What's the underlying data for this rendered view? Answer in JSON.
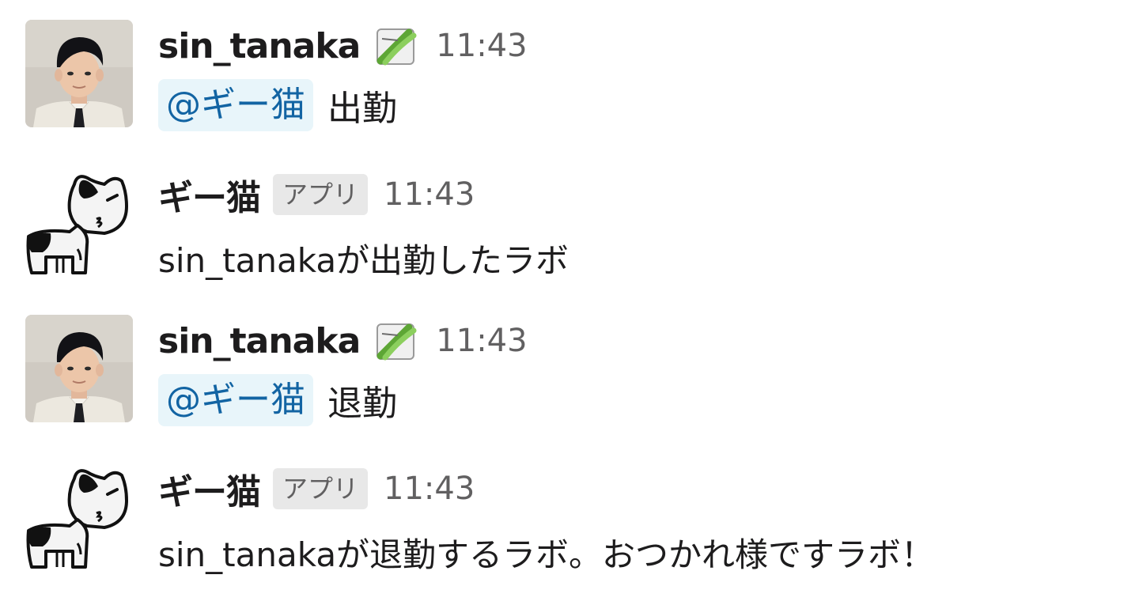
{
  "messages": [
    {
      "author": "sin_tanaka",
      "time": "11:43",
      "mention": "@ギー猫",
      "text": "出勤",
      "status_icon": "green-leaf-status-icon"
    },
    {
      "author": "ギー猫",
      "badge": "アプリ",
      "time": "11:43",
      "text": "sin_tanakaが出勤したラボ"
    },
    {
      "author": "sin_tanaka",
      "time": "11:43",
      "mention": "@ギー猫",
      "text": "退勤",
      "status_icon": "green-leaf-status-icon"
    },
    {
      "author": "ギー猫",
      "badge": "アプリ",
      "time": "11:43",
      "text": "sin_tanakaが退勤するラボ。おつかれ様ですラボ！"
    }
  ],
  "colors": {
    "mention_bg": "#e8f5fa",
    "mention_text": "#1264a3",
    "badge_bg": "#e8e8e8",
    "muted_text": "#616061",
    "status_green": "#6fbf3f"
  }
}
